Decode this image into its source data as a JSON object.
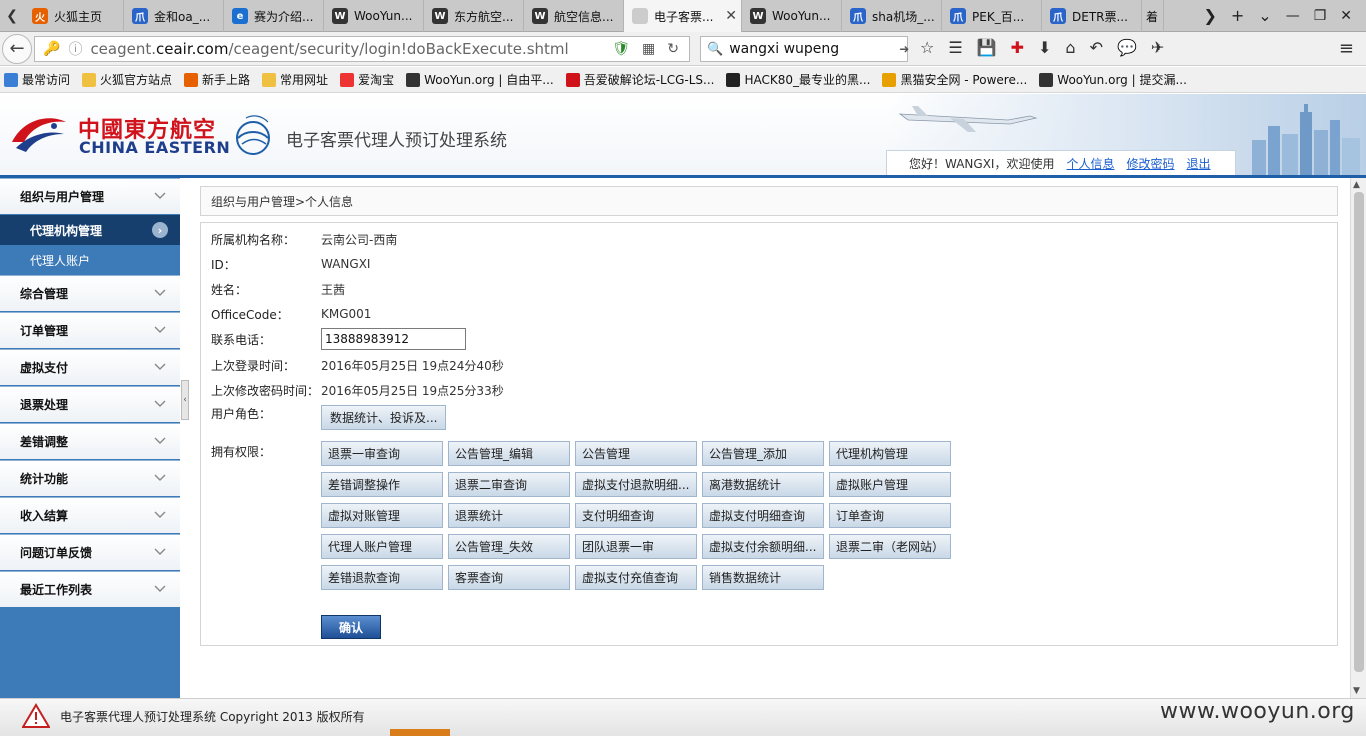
{
  "browser": {
    "tabs": [
      {
        "label": "火狐主页",
        "fav_color": "#e66000",
        "fav_glyph": "火"
      },
      {
        "label": "金和oa_...",
        "fav_color": "#2a64c8",
        "fav_glyph": "爪"
      },
      {
        "label": "赛为介绍...",
        "fav_color": "#1a6fd0",
        "fav_glyph": "e"
      },
      {
        "label": "WooYun...",
        "fav_color": "#333333",
        "fav_glyph": "W"
      },
      {
        "label": "东方航空...",
        "fav_color": "#333333",
        "fav_glyph": "W"
      },
      {
        "label": "航空信息...",
        "fav_color": "#333333",
        "fav_glyph": "W"
      },
      {
        "label": "电子客票...",
        "fav_color": "#cccccc",
        "fav_glyph": ""
      },
      {
        "label": "WooYun...",
        "fav_color": "#333333",
        "fav_glyph": "W"
      },
      {
        "label": "sha机场_...",
        "fav_color": "#2a64c8",
        "fav_glyph": "爪"
      },
      {
        "label": "PEK_百...",
        "fav_color": "#2a64c8",
        "fav_glyph": "爪"
      },
      {
        "label": "DETR票...",
        "fav_color": "#2a64c8",
        "fav_glyph": "爪"
      }
    ],
    "active_tab_index": 6,
    "active_tab_close": "✕",
    "tab_extra_label": "着",
    "url": {
      "prefix": "ceagent.",
      "domain": "ceair.com",
      "path": "/ceagent/security/login!doBackExecute.shtml"
    },
    "search_value": "wangxi wupeng",
    "bookmarks": [
      {
        "label": "最常访问",
        "icon_color": "#3a7fd5"
      },
      {
        "label": "火狐官方站点",
        "icon_color": "#f0c040"
      },
      {
        "label": "新手上路",
        "icon_color": "#e66000"
      },
      {
        "label": "常用网址",
        "icon_color": "#f0c040"
      },
      {
        "label": "爱淘宝",
        "icon_color": "#ee3333"
      },
      {
        "label": "WooYun.org | 自由平...",
        "icon_color": "#333333"
      },
      {
        "label": "吾爱破解论坛-LCG-LS...",
        "icon_color": "#d0121b"
      },
      {
        "label": "HACK80_最专业的黑...",
        "icon_color": "#222222"
      },
      {
        "label": "黑猫安全网 - Powere...",
        "icon_color": "#e8a000"
      },
      {
        "label": "WooYun.org | 提交漏...",
        "icon_color": "#333333"
      }
    ]
  },
  "header": {
    "logo_cn": "中國東方航空",
    "logo_en": "CHINA EASTERN",
    "system_title": "电子客票代理人预订处理系统",
    "greeting": "您好！WANGXI，欢迎使用",
    "links": [
      "个人信息",
      "修改密码",
      "退出"
    ]
  },
  "sidebar": {
    "groups": [
      {
        "label": "组织与用户管理",
        "children": [
          {
            "label": "代理机构管理",
            "active": true
          },
          {
            "label": "代理人账户",
            "active": false
          }
        ]
      },
      {
        "label": "综合管理"
      },
      {
        "label": "订单管理"
      },
      {
        "label": "虚拟支付"
      },
      {
        "label": "退票处理"
      },
      {
        "label": "差错调整"
      },
      {
        "label": "统计功能"
      },
      {
        "label": "收入结算"
      },
      {
        "label": "问题订单反馈"
      },
      {
        "label": "最近工作列表"
      }
    ]
  },
  "main": {
    "breadcrumb": "组织与用户管理>个人信息",
    "fields": {
      "org_label": "所属机构名称：",
      "org_value": "云南公司-西南",
      "id_label": "ID：",
      "id_value": "WANGXI",
      "name_label": "姓名：",
      "name_value": "王茜",
      "office_label": "OfficeCode：",
      "office_value": "KMG001",
      "phone_label": "联系电话：",
      "phone_value": "13888983912",
      "last_login_label": "上次登录时间：",
      "last_login_value": "2016年05月25日 19点24分40秒",
      "last_pwd_label": "上次修改密码时间：",
      "last_pwd_value": "2016年05月25日 19点25分33秒",
      "role_label": "用户角色：",
      "role_value": "数据统计、投诉及..."
    },
    "permissions_label": "拥有权限：",
    "permissions": [
      "退票一审查询",
      "公告管理_编辑",
      "公告管理",
      "公告管理_添加",
      "代理机构管理",
      "差错调整操作",
      "退票二审查询",
      "虚拟支付退款明细...",
      "离港数据统计",
      "虚拟账户管理",
      "虚拟对账管理",
      "退票统计",
      "支付明细查询",
      "虚拟支付明细查询",
      "订单查询",
      "代理人账户管理",
      "公告管理_失效",
      "团队退票一审",
      "虚拟支付余额明细...",
      "退票二审（老网站）",
      "差错退款查询",
      "客票查询",
      "虚拟支付充值查询",
      "销售数据统计"
    ],
    "confirm_label": "确认"
  },
  "footer": {
    "text": "电子客票代理人预订处理系统 Copyright 2013 版权所有",
    "watermark": "www.wooyun.org"
  },
  "colors": {
    "brand_red": "#d0121b",
    "brand_blue": "#1f3f8c",
    "sidebar_blue": "#3d7ab8",
    "active_nav": "#163f6e",
    "link_blue": "#1a5fd0"
  }
}
